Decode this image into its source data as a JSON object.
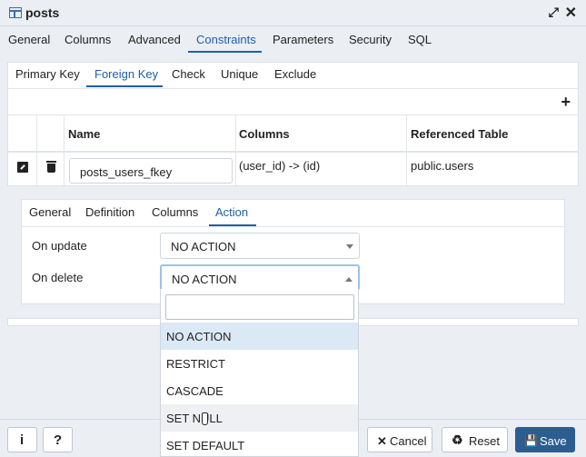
{
  "window": {
    "title": "posts",
    "icons": [
      "table-icon",
      "expand-icon",
      "close-icon"
    ],
    "expand_glyph": "⤢",
    "close_glyph": "✕"
  },
  "main_tabs": {
    "items": [
      "General",
      "Columns",
      "Advanced",
      "Constraints",
      "Parameters",
      "Security",
      "SQL"
    ],
    "active": "Constraints"
  },
  "constraint_tabs": {
    "items": [
      "Primary Key",
      "Foreign Key",
      "Check",
      "Unique",
      "Exclude"
    ],
    "active": "Foreign Key",
    "add_glyph": "+"
  },
  "grid": {
    "columns": [
      "Name",
      "Columns",
      "Referenced Table"
    ],
    "rows": [
      {
        "name": "posts_users_fkey",
        "columns": "(user_id) -> (id)",
        "referenced_table": "public.users"
      }
    ]
  },
  "detail_tabs": {
    "items": [
      "General",
      "Definition",
      "Columns",
      "Action"
    ],
    "active": "Action"
  },
  "action": {
    "on_update": {
      "label": "On update",
      "value": "NO ACTION"
    },
    "on_delete": {
      "label": "On delete",
      "value": "NO ACTION"
    }
  },
  "dropdown": {
    "search_value": "",
    "options": [
      "NO ACTION",
      "RESTRICT",
      "CASCADE",
      "SET NULL",
      "SET DEFAULT"
    ],
    "selected": "NO ACTION",
    "hovered": "SET NULL"
  },
  "footer": {
    "info_glyph": "i",
    "help_glyph": "?",
    "cancel": {
      "icon": "x-icon",
      "glyph": "✕",
      "label": "Cancel"
    },
    "reset": {
      "icon": "recycle-icon",
      "glyph": "♻",
      "label": "Reset"
    },
    "save": {
      "icon": "floppy-disk-icon",
      "glyph": "💾",
      "label": "Save"
    }
  },
  "colors": {
    "accent": "#2060a8",
    "save_button": "#2c5d91",
    "selected_option": "#dbe9f7"
  }
}
